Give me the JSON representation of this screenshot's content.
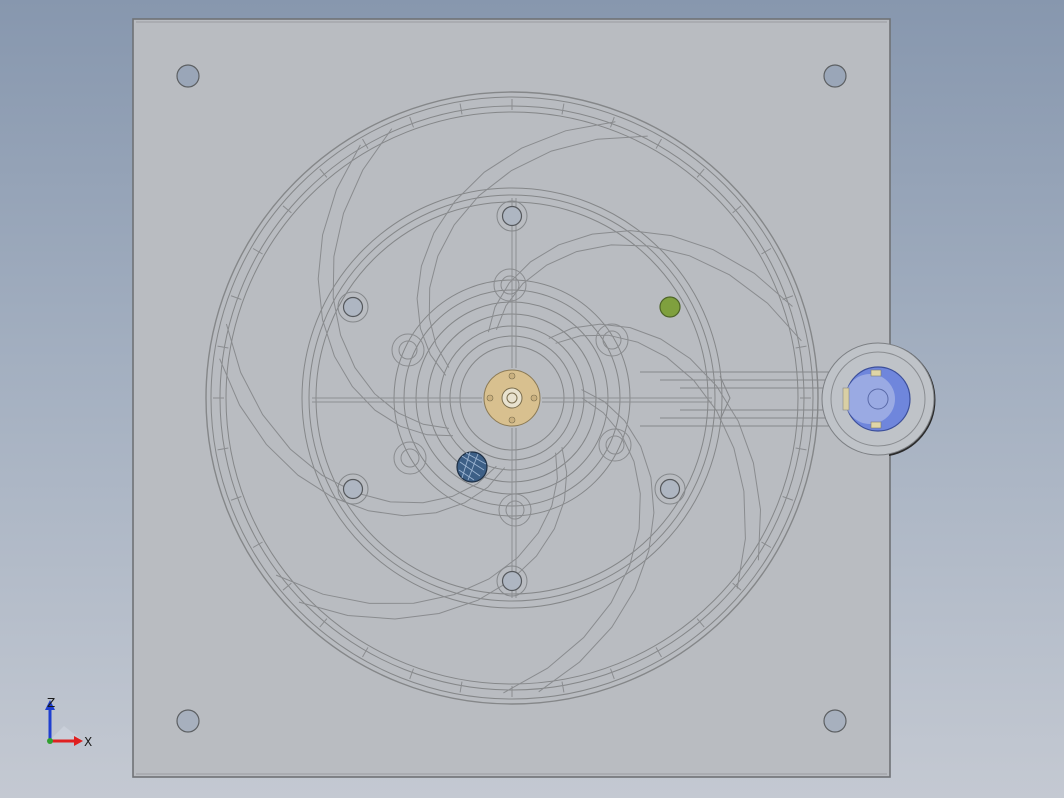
{
  "colors": {
    "background_top": "#8797ae",
    "background_bottom": "#c4c9d2",
    "plate_fill": "#b9bcc1",
    "edge_line": "#7d7f83",
    "hub": "#d8c08f",
    "green_pin": "#7fa03e",
    "blue_pin": "#3d5f86",
    "motor_face": "#6f86dc",
    "axis_x": "#e02020",
    "axis_z": "#1f3fd0",
    "axis_y": "#30a030"
  },
  "view_triad": {
    "label_z": "Z",
    "label_x": "X",
    "icon": "triad-icon"
  },
  "model": {
    "component_count_holes": 4,
    "blade_count": 7,
    "bolt_circle_holes": 6
  }
}
